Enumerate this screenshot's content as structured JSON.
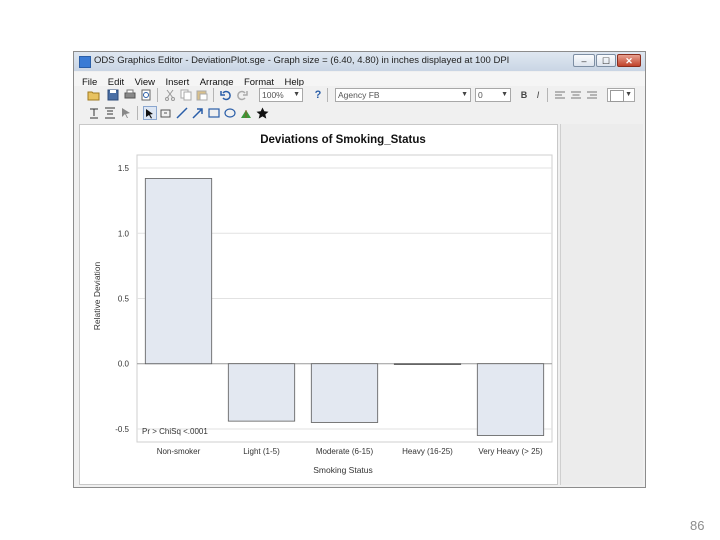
{
  "window": {
    "title": "ODS Graphics Editor - DeviationPlot.sge - Graph size = (6.40, 4.80) in inches displayed at 100 DPI",
    "minimize_label": "–",
    "maximize_label": "☐",
    "close_label": "✕"
  },
  "menu": [
    "File",
    "Edit",
    "View",
    "Insert",
    "Arrange",
    "Format",
    "Help"
  ],
  "toolbar": {
    "zoom_value": "100%",
    "help_label": "?",
    "font_value": "Agency FB",
    "font_size_value": "0",
    "bold_label": "B",
    "italic_label": "I"
  },
  "icons": {
    "open": "open-folder-icon",
    "save": "save-icon",
    "print": "print-icon",
    "preview": "print-preview-icon",
    "cut": "cut-icon",
    "copy": "copy-icon",
    "paste": "paste-icon",
    "undo": "undo-icon",
    "redo": "redo-icon",
    "select": "select-arrow-icon",
    "line": "line-icon",
    "arrow": "arrow-icon",
    "rect": "rectangle-icon",
    "oval": "oval-icon",
    "star": "star-icon"
  },
  "colors": {
    "bar_fill": "#e3e8f1",
    "bar_stroke": "#5a5a5a",
    "title_bg": "#d2dceb",
    "close_red": "#c0432b"
  },
  "chart_data": {
    "type": "bar",
    "title": "Deviations of Smoking_Status",
    "xlabel": "Smoking Status",
    "ylabel": "Relative Deviation",
    "categories": [
      "Non-smoker",
      "Light (1-5)",
      "Moderate (6-15)",
      "Heavy (16-25)",
      "Very Heavy (> 25)"
    ],
    "values": [
      1.42,
      -0.44,
      -0.45,
      0.0,
      -0.55
    ],
    "ylim": [
      -0.6,
      1.6
    ],
    "yticks": [
      1.5,
      1.0,
      0.5,
      0.0,
      -0.5
    ],
    "ytick_labels": [
      "1.5",
      "1.0",
      "0.5",
      "0.0",
      "-0.5"
    ],
    "grid": true,
    "annotation": "Pr > ChiSq <.0001"
  },
  "slide_number": "86"
}
